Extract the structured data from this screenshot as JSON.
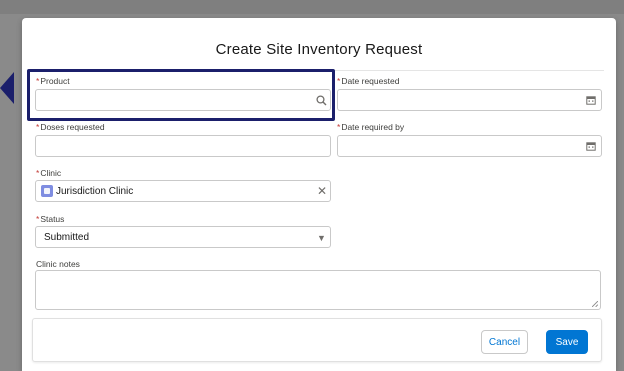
{
  "modal": {
    "title": "Create Site Inventory Request"
  },
  "fields": {
    "product": {
      "label": "Product",
      "required_mark": "*",
      "value": "",
      "icon": "search-icon"
    },
    "date_requested": {
      "label": "Date requested",
      "required_mark": "*",
      "value": "",
      "icon": "calendar-icon"
    },
    "doses_requested": {
      "label": "Doses requested",
      "required_mark": "*",
      "value": ""
    },
    "date_required_by": {
      "label": "Date required by",
      "required_mark": "*",
      "value": "",
      "icon": "calendar-icon"
    },
    "clinic": {
      "label": "Clinic",
      "required_mark": "*",
      "value": "Jurisdiction Clinic",
      "icon": "clinic-record-icon",
      "clear_icon": "close-icon"
    },
    "status": {
      "label": "Status",
      "required_mark": "*",
      "value": "Submitted",
      "icon": "caret-down-icon"
    },
    "clinic_notes": {
      "label": "Clinic notes",
      "value": ""
    }
  },
  "footer": {
    "cancel_label": "Cancel",
    "save_label": "Save"
  },
  "colors": {
    "highlight": "#1b1f6b",
    "brand": "#0176d3",
    "required": "#c23934"
  }
}
